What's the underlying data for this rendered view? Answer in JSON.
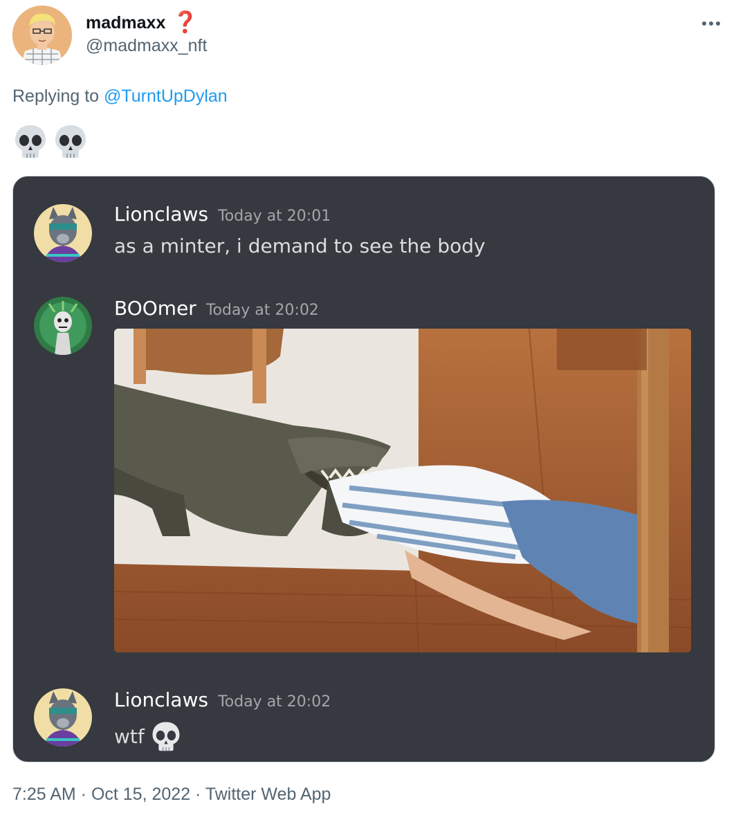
{
  "tweet": {
    "display_name": "madmaxx",
    "name_badge": "❓",
    "handle": "@madmaxx_nft",
    "more_icon": "more-icon",
    "reply_prefix": "Replying to",
    "reply_to": "@TurntUpDylan",
    "body_emoji": [
      "skull-icon",
      "skull-icon"
    ],
    "timestamp": "7:25 AM · Oct 15, 2022 · Twitter Web App"
  },
  "discord": {
    "messages": [
      {
        "user": "Lionclaws",
        "time": "Today at 20:01",
        "text": "as a minter, i demand to see the body"
      },
      {
        "user": "BOOmer",
        "time": "Today at 20:02",
        "text": "",
        "image": "crocodile-photo"
      },
      {
        "user": "Lionclaws",
        "time": "Today at 20:02",
        "text": "wtf"
      }
    ]
  },
  "colors": {
    "accent": "#1d9bf0",
    "discord_bg": "#36393f",
    "muted": "#536471"
  }
}
